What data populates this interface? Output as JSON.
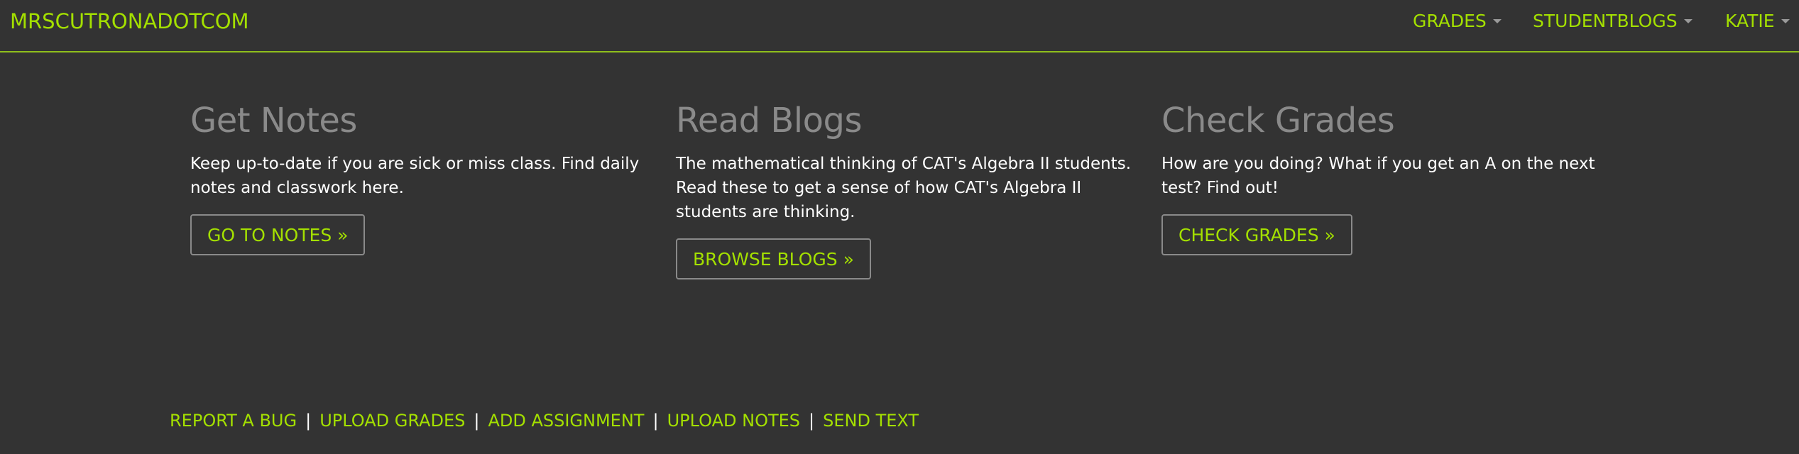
{
  "navbar": {
    "brand": "MRSCUTRONADOTCOM",
    "items": [
      {
        "label": "GRADES"
      },
      {
        "label": "STUDENTBLOGS"
      },
      {
        "label": "KATIE"
      }
    ]
  },
  "columns": [
    {
      "title": "Get Notes",
      "text": "Keep up-to-date if you are sick or miss class. Find daily notes and classwork here.",
      "button": "GO TO NOTES »"
    },
    {
      "title": "Read Blogs",
      "text": "The mathematical thinking of CAT's Algebra II students. Read these to get a sense of how CAT's Algebra II students are thinking.",
      "button": "BROWSE BLOGS »"
    },
    {
      "title": "Check Grades",
      "text": "How are you doing? What if you get an A on the next test? Find out!",
      "button": "CHECK GRADES »"
    }
  ],
  "footer": {
    "links": [
      "REPORT A BUG",
      "UPLOAD GRADES",
      "ADD ASSIGNMENT",
      "UPLOAD NOTES",
      "SEND TEXT"
    ],
    "separator": "|"
  },
  "colors": {
    "background": "#333333",
    "accent": "#a4e000",
    "heading": "#8a8a8a",
    "text": "#ffffff"
  }
}
